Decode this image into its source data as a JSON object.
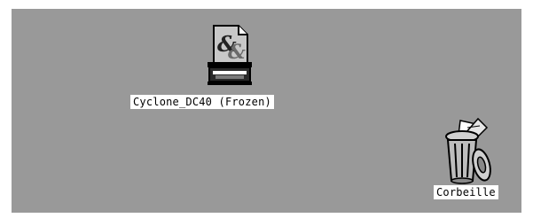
{
  "desktop": {
    "background": "#999999",
    "icons": [
      {
        "id": "cyclone",
        "label": "Cyclone_DC40 (Frozen)",
        "icon": "frozen-archive-document-icon"
      },
      {
        "id": "trash",
        "label": "Corbeille",
        "icon": "trash-full-icon"
      }
    ]
  }
}
